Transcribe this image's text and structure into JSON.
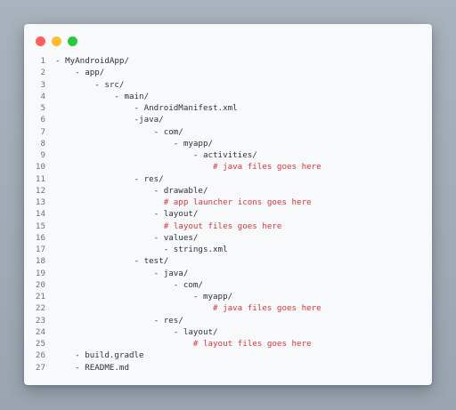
{
  "window": {
    "traffic_lights": [
      {
        "name": "close",
        "color": "#ff5f57"
      },
      {
        "name": "minimize",
        "color": "#febc2e"
      },
      {
        "name": "zoom",
        "color": "#28c840"
      }
    ]
  },
  "code": {
    "comment_color": "#d9383a",
    "text_color": "#2d333b",
    "lines": [
      {
        "n": "1",
        "text": "- MyAndroidApp/",
        "comment": false
      },
      {
        "n": "2",
        "text": "    - app/",
        "comment": false
      },
      {
        "n": "3",
        "text": "        - src/",
        "comment": false
      },
      {
        "n": "4",
        "text": "            - main/",
        "comment": false
      },
      {
        "n": "5",
        "text": "                - AndroidManifest.xml",
        "comment": false
      },
      {
        "n": "6",
        "text": "                -java/",
        "comment": false
      },
      {
        "n": "7",
        "text": "                    - com/",
        "comment": false
      },
      {
        "n": "8",
        "text": "                        - myapp/",
        "comment": false
      },
      {
        "n": "9",
        "text": "                            - activities/",
        "comment": false
      },
      {
        "n": "10",
        "text": "                                # java files goes here",
        "comment": true
      },
      {
        "n": "11",
        "text": "                - res/",
        "comment": false
      },
      {
        "n": "12",
        "text": "                    - drawable/",
        "comment": false
      },
      {
        "n": "13",
        "text": "                      # app launcher icons goes here",
        "comment": true
      },
      {
        "n": "14",
        "text": "                    - layout/",
        "comment": false
      },
      {
        "n": "15",
        "text": "                      # layout files goes here",
        "comment": true
      },
      {
        "n": "16",
        "text": "                    - values/",
        "comment": false
      },
      {
        "n": "17",
        "text": "                      - strings.xml",
        "comment": false
      },
      {
        "n": "18",
        "text": "                - test/",
        "comment": false
      },
      {
        "n": "19",
        "text": "                    - java/",
        "comment": false
      },
      {
        "n": "20",
        "text": "                        - com/",
        "comment": false
      },
      {
        "n": "21",
        "text": "                            - myapp/",
        "comment": false
      },
      {
        "n": "22",
        "text": "                                # java files goes here",
        "comment": true
      },
      {
        "n": "23",
        "text": "                    - res/",
        "comment": false
      },
      {
        "n": "24",
        "text": "                        - layout/",
        "comment": false
      },
      {
        "n": "25",
        "text": "                            # layout files goes here",
        "comment": true
      },
      {
        "n": "26",
        "text": "    - build.gradle",
        "comment": false
      },
      {
        "n": "27",
        "text": "    - README.md",
        "comment": false
      }
    ]
  }
}
